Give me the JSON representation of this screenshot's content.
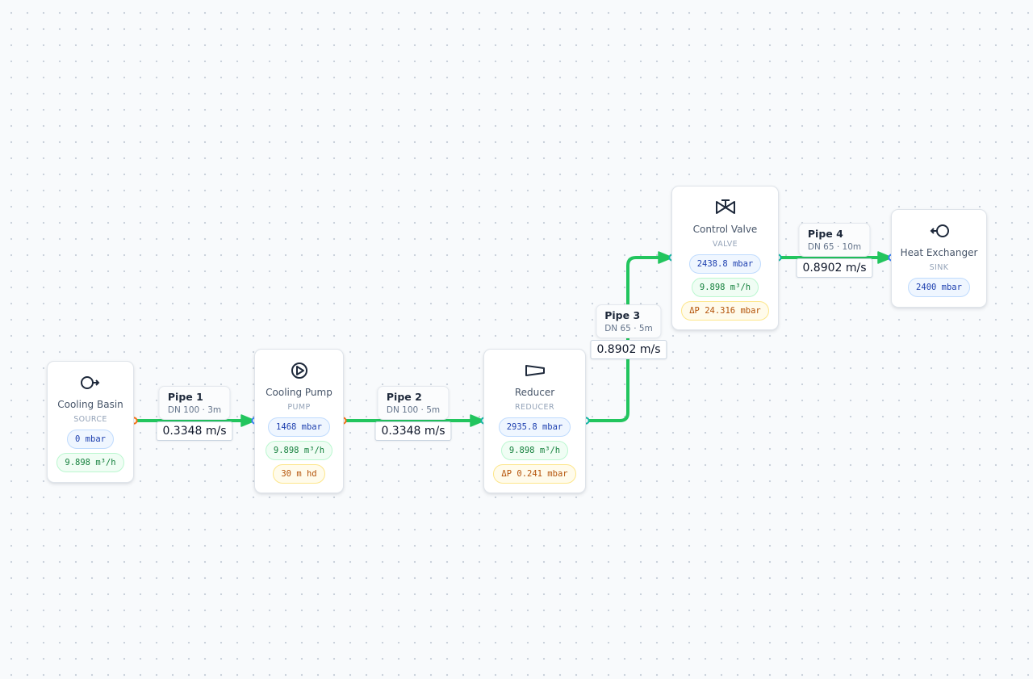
{
  "colors": {
    "edge": "#22c55e",
    "port_out": "#f97316",
    "port_in": "#3b82f6",
    "port_teal": "#14b8a6"
  },
  "nodes": [
    {
      "id": "cooling-basin",
      "icon": "source-arrow-icon",
      "title": "Cooling Basin",
      "type": "SOURCE",
      "chips": [
        {
          "kind": "pressure",
          "text": "0 mbar"
        },
        {
          "kind": "flow",
          "text": "9.898 m³/h"
        }
      ]
    },
    {
      "id": "cooling-pump",
      "icon": "pump-icon",
      "title": "Cooling Pump",
      "type": "PUMP",
      "chips": [
        {
          "kind": "pressure",
          "text": "1468 mbar"
        },
        {
          "kind": "flow",
          "text": "9.898 m³/h"
        },
        {
          "kind": "head",
          "text": "30 m hd"
        }
      ]
    },
    {
      "id": "reducer",
      "icon": "reducer-icon",
      "title": "Reducer",
      "type": "REDUCER",
      "chips": [
        {
          "kind": "pressure",
          "text": "2935.8 mbar"
        },
        {
          "kind": "flow",
          "text": "9.898 m³/h"
        },
        {
          "kind": "head",
          "text": "ΔP 0.241 mbar"
        }
      ]
    },
    {
      "id": "control-valve",
      "icon": "valve-icon",
      "title": "Control Valve",
      "type": "VALVE",
      "chips": [
        {
          "kind": "pressure",
          "text": "2438.8 mbar"
        },
        {
          "kind": "flow",
          "text": "9.898 m³/h"
        },
        {
          "kind": "head",
          "text": "ΔP 24.316 mbar"
        }
      ]
    },
    {
      "id": "heat-exchanger",
      "icon": "sink-arrow-icon",
      "title": "Heat Exchanger",
      "type": "SINK",
      "chips": [
        {
          "kind": "pressure",
          "text": "2400 mbar"
        }
      ]
    }
  ],
  "pipes": [
    {
      "id": "pipe-1",
      "from": "cooling-basin",
      "to": "cooling-pump",
      "name": "Pipe 1",
      "spec": "DN 100 · 3m",
      "velocity": "0.3348 m/s"
    },
    {
      "id": "pipe-2",
      "from": "cooling-pump",
      "to": "reducer",
      "name": "Pipe 2",
      "spec": "DN 100 · 5m",
      "velocity": "0.3348 m/s"
    },
    {
      "id": "pipe-3",
      "from": "reducer",
      "to": "control-valve",
      "name": "Pipe 3",
      "spec": "DN 65 · 5m",
      "velocity": "0.8902 m/s"
    },
    {
      "id": "pipe-4",
      "from": "control-valve",
      "to": "heat-exchanger",
      "name": "Pipe 4",
      "spec": "DN 65 · 10m",
      "velocity": "0.8902 m/s"
    }
  ]
}
